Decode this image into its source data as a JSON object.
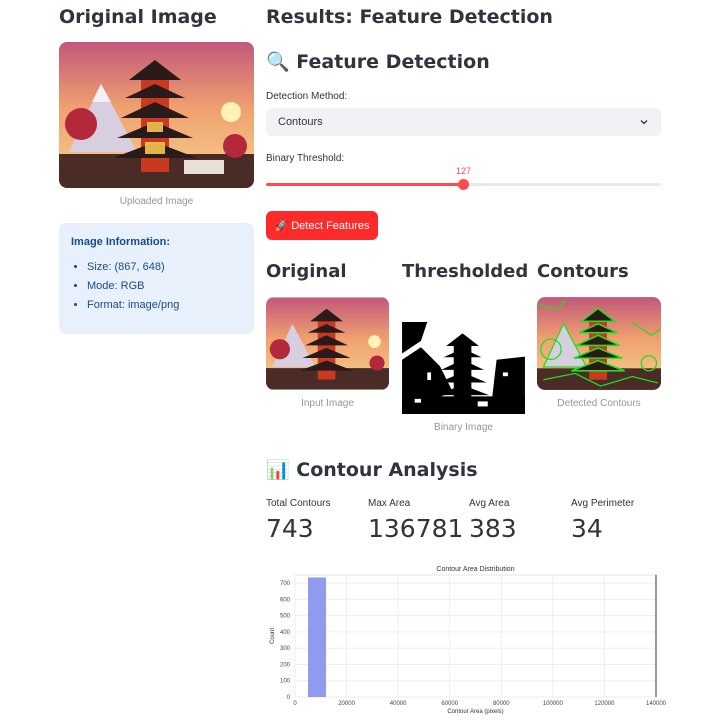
{
  "left": {
    "heading": "Original Image",
    "image_caption": "Uploaded Image",
    "info": {
      "title": "Image Information:",
      "items": [
        "Size: (867, 648)",
        "Mode: RGB",
        "Format: image/png"
      ]
    }
  },
  "right": {
    "heading": "Results: Feature Detection",
    "section_title": "🔍 Feature Detection",
    "method_label": "Detection Method:",
    "method_value": "Contours",
    "threshold_label": "Binary Threshold:",
    "threshold_value": "127",
    "threshold_fraction": 0.5,
    "detect_button": "🚀 Detect Features",
    "columns": [
      {
        "title": "Original",
        "caption": "Input Image"
      },
      {
        "title": "Thresholded",
        "caption": "Binary Image"
      },
      {
        "title": "Contours",
        "caption": "Detected Contours"
      }
    ],
    "analysis_title": "📊 Contour Analysis",
    "metrics": [
      {
        "label": "Total Contours",
        "value": "743"
      },
      {
        "label": "Max Area",
        "value": "136781"
      },
      {
        "label": "Avg Area",
        "value": "383"
      },
      {
        "label": "Avg Perimeter",
        "value": "34"
      }
    ]
  },
  "colors": {
    "accent": "#ff4b4b",
    "button": "#ff2b2b",
    "info_bg": "#e7f0fb",
    "bar": "#8f9cee"
  },
  "chart_data": {
    "type": "bar",
    "title": "Contour Area Distribution",
    "xlabel": "Contour Area (pixels)",
    "ylabel": "Count",
    "xlim": [
      0,
      140000
    ],
    "ylim": [
      0,
      750
    ],
    "xticks": [
      "0",
      "20000",
      "40000",
      "60000",
      "80000",
      "100000",
      "120000",
      "140000"
    ],
    "yticks": [
      "0",
      "100",
      "200",
      "300",
      "400",
      "500",
      "600",
      "700"
    ],
    "bins": [
      {
        "x0": 0,
        "x1": 7000,
        "count": 735
      }
    ]
  }
}
